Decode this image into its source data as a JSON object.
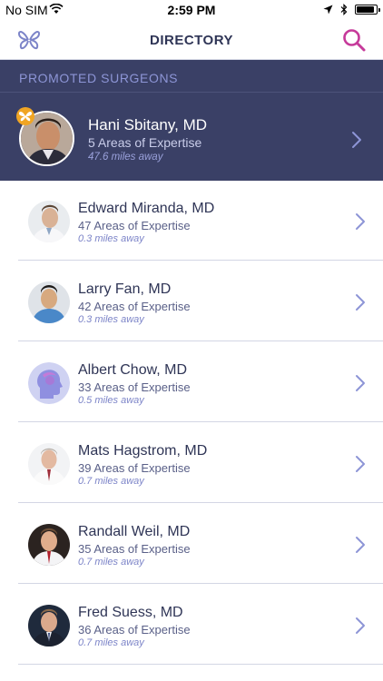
{
  "status_bar": {
    "carrier": "No SIM",
    "time": "2:59 PM",
    "battery_level": 0.9
  },
  "nav": {
    "title": "DIRECTORY",
    "logo_icon": "butterfly-logo-icon",
    "search_icon": "search-icon"
  },
  "promoted": {
    "header": "PROMOTED SURGEONS",
    "surgeon": {
      "name": "Hani Sbitany, MD",
      "expertise": "5 Areas of Expertise",
      "distance": "47.6 miles away",
      "badge_icon": "butterfly-badge-icon"
    }
  },
  "surgeons": [
    {
      "name": "Edward Miranda, MD",
      "expertise": "47 Areas of Expertise",
      "distance": "0.3 miles away"
    },
    {
      "name": "Larry Fan, MD",
      "expertise": "42 Areas of Expertise",
      "distance": "0.3 miles away"
    },
    {
      "name": "Albert Chow, MD",
      "expertise": "33 Areas of Expertise",
      "distance": "0.5 miles away",
      "avatar": "placeholder-head-icon"
    },
    {
      "name": "Mats Hagstrom, MD",
      "expertise": "39 Areas of Expertise",
      "distance": "0.7 miles away"
    },
    {
      "name": "Randall Weil, MD",
      "expertise": "35 Areas of Expertise",
      "distance": "0.7 miles away"
    },
    {
      "name": "Fred Suess, MD",
      "expertise": "36 Areas of Expertise",
      "distance": "0.7 miles away"
    }
  ],
  "colors": {
    "accent": "#3a4066",
    "search_accent": "#c63a9a",
    "link_blue": "#7c84c8"
  }
}
